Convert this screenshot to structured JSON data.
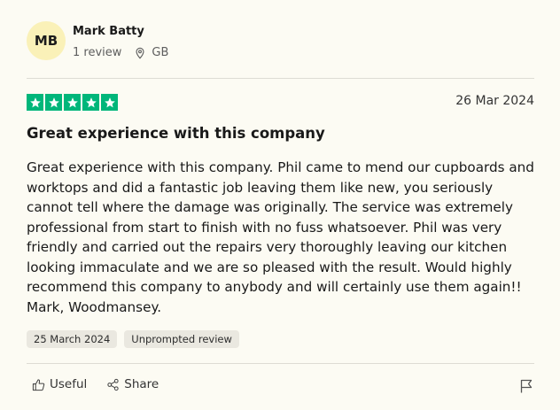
{
  "reviewer": {
    "initials": "MB",
    "name": "Mark Batty",
    "review_count": "1 review",
    "country": "GB"
  },
  "review": {
    "rating": 5,
    "date": "26 Mar 2024",
    "title": "Great experience with this company",
    "body": "Great experience with this company. Phil came to mend our cupboards and worktops and did a fantastic job leaving them like new, you seriously cannot tell where the damage was originally. The service was extremely professional from start to finish with no fuss whatsoever. Phil was very friendly and carried out the repairs very thoroughly leaving our kitchen looking immaculate and we are so pleased with the result. Would highly recommend this company to anybody and will certainly use them again!!\nMark, Woodmansey.",
    "experience_date": "25 March 2024",
    "review_type": "Unprompted review"
  },
  "actions": {
    "useful_label": "Useful",
    "share_label": "Share"
  },
  "colors": {
    "star_green": "#00b67a",
    "avatar_bg": "#faf1b8",
    "page_bg": "#fcfbf3"
  },
  "icons": [
    "location-pin-icon",
    "star-icon",
    "thumbs-up-icon",
    "share-icon",
    "flag-icon"
  ]
}
